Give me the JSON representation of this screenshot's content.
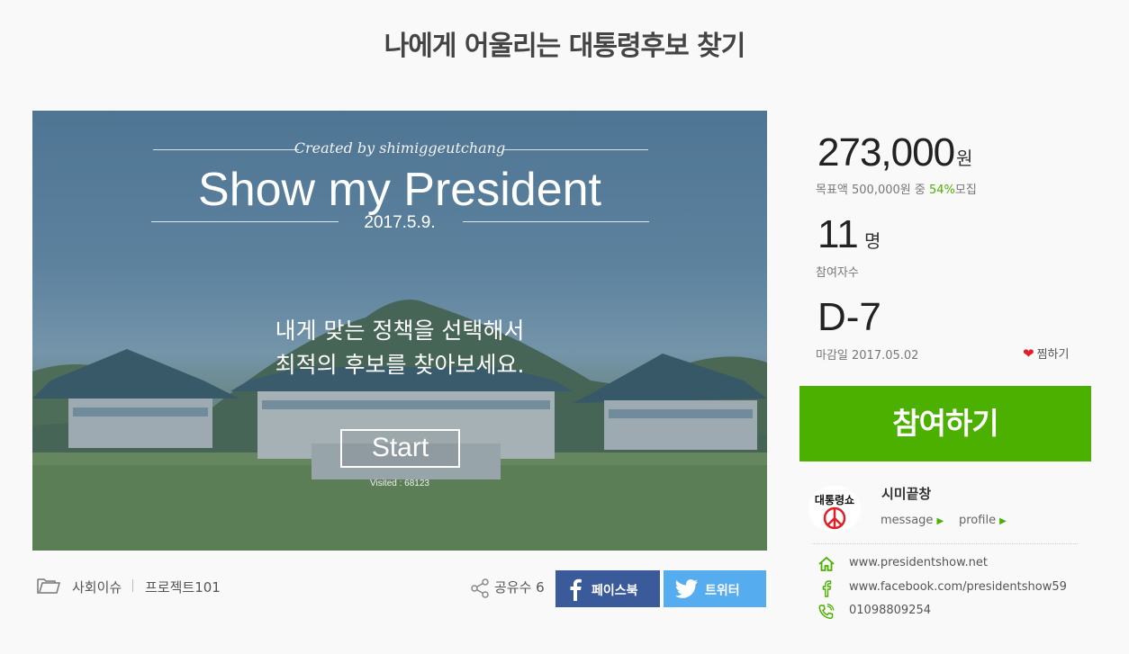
{
  "header": {
    "title": "나에게 어울리는 대통령후보 찾기"
  },
  "hero": {
    "credit": "Created by shimiggeutchang",
    "title": "Show my President",
    "date": "2017.5.9.",
    "message_line1": "내게 맞는 정책을 선택해서",
    "message_line2": "최적의 후보를 찾아보세요.",
    "start_label": "Start",
    "visited": "Visited : 68123"
  },
  "meta": {
    "category1": "사회이슈",
    "category2": "프로젝트101",
    "share_label": "공유수 6",
    "facebook_label": "페이스북",
    "twitter_label": "트위터"
  },
  "funding": {
    "amount": "273,000",
    "amount_unit": "원",
    "goal_prefix": "목표액 500,000원 중 ",
    "goal_percent": "54%",
    "goal_suffix": "모집",
    "participants": "11",
    "participants_unit": "명",
    "participants_label": "참여자수",
    "dday": "D-7",
    "deadline": "마감일 2017.05.02",
    "like_label": "찜하기",
    "join_label": "참여하기"
  },
  "creator": {
    "avatar_text": "대통령쇼",
    "name": "시미끝창",
    "message_label": "message",
    "profile_label": "profile"
  },
  "contacts": [
    {
      "icon": "home-icon",
      "text": "www.presidentshow.net"
    },
    {
      "icon": "facebook-icon",
      "text": "www.facebook.com/presidentshow59"
    },
    {
      "icon": "phone-icon",
      "text": "01098809254"
    }
  ],
  "colors": {
    "accent": "#4cb000",
    "facebook": "#3a5a9a",
    "twitter": "#55acee",
    "heart": "#e41e26"
  }
}
